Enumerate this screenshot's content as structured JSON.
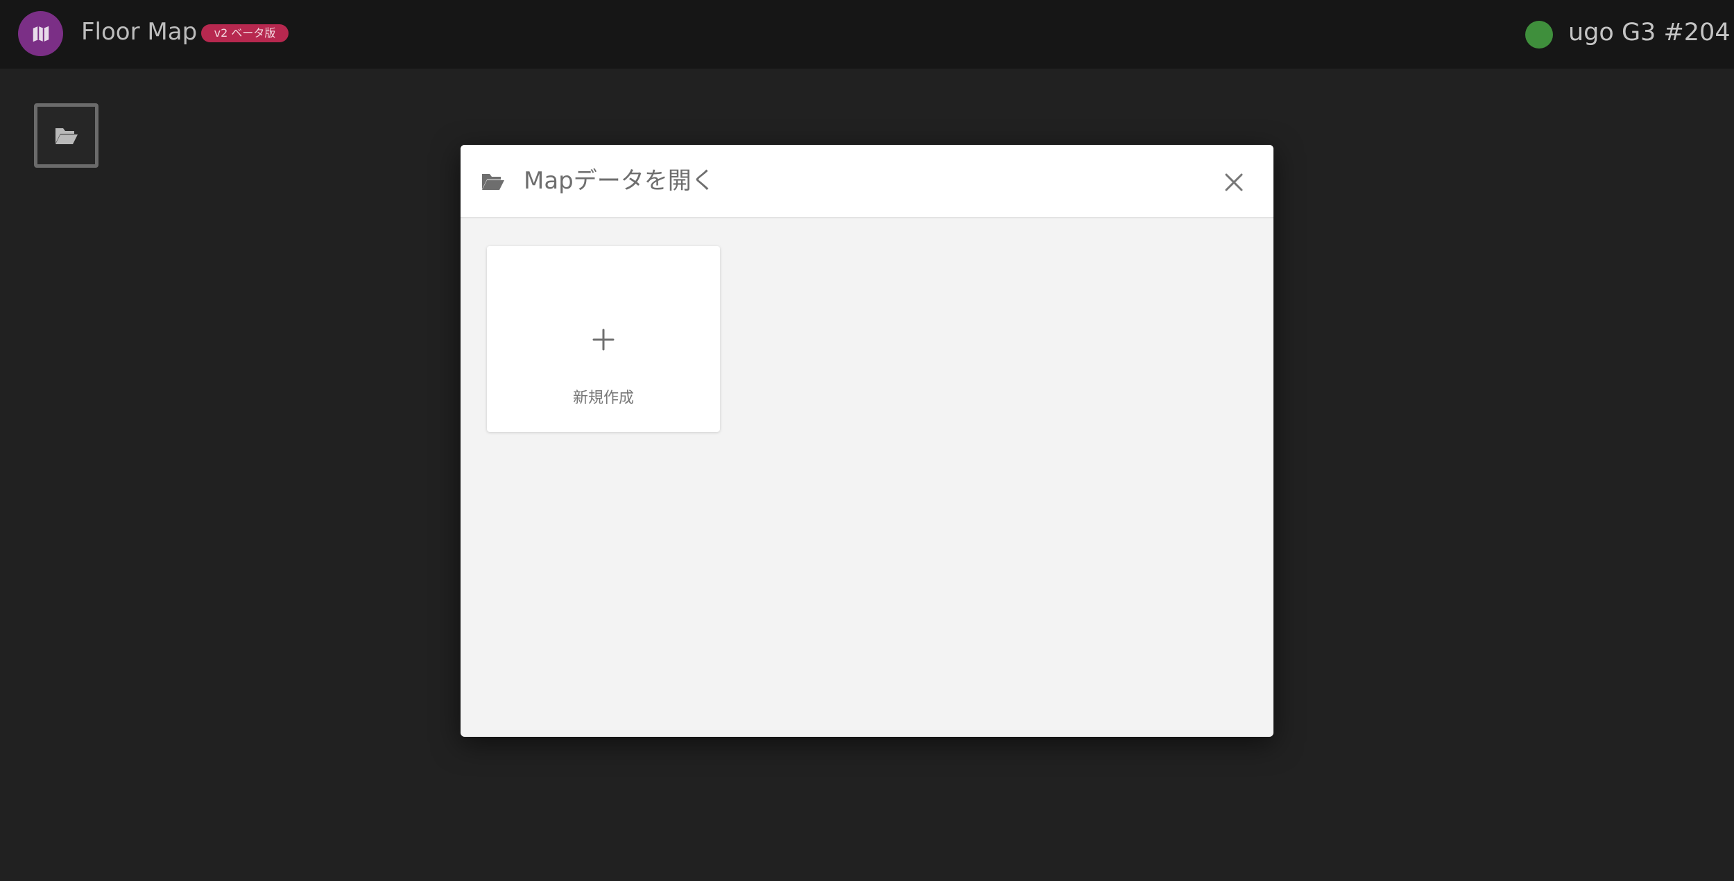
{
  "app": {
    "title": "Floor Map",
    "badge": "v2 ベータ版",
    "logo_icon": "map-icon",
    "brand_color": "#7b2f86",
    "badge_color": "#b7284f"
  },
  "robot": {
    "name": "ugo G3 #204",
    "status_color": "#3f8f3c"
  },
  "toolbar": {
    "open_icon": "folder-open-icon"
  },
  "dialog": {
    "title": "Mapデータを開く",
    "title_icon": "folder-open-icon",
    "close_icon": "close-icon",
    "new_card": {
      "icon": "plus-icon",
      "label": "新規作成"
    }
  }
}
